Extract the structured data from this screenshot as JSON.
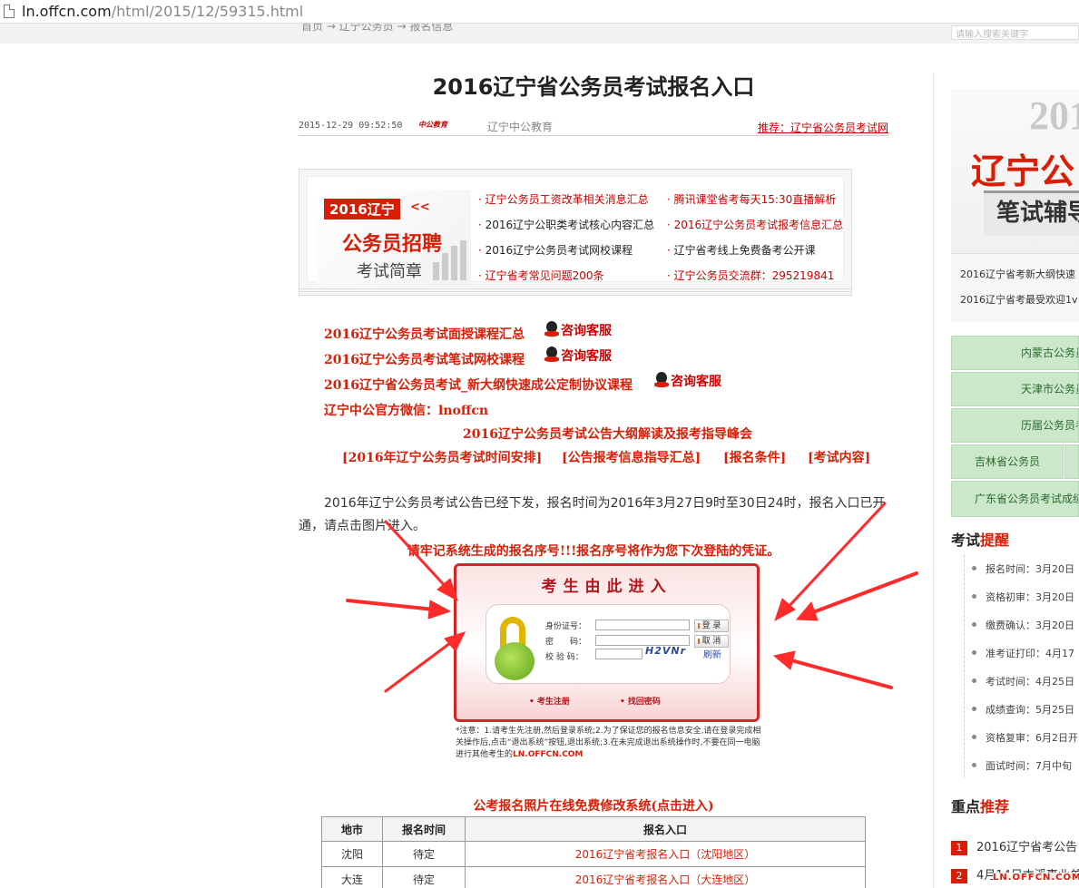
{
  "browser": {
    "url_host": "ln.offcn.com",
    "url_path": "/html/2015/12/59315.html"
  },
  "nav": {
    "crumbs": "首页 → 辽宁公务员 → 报名信息",
    "search_placeholder": "请输入搜索关键字"
  },
  "article": {
    "title": "2016辽宁省公务员考试报名入口",
    "date": "2015-12-29 09:52:50",
    "logo_text": "中公教育",
    "source": "辽宁中公教育",
    "recommend": "推荐：辽宁省公务员考试网"
  },
  "banner": {
    "tag": "2016辽宁",
    "arrows": "<<",
    "title": "公务员招聘",
    "subtitle": "考试简章",
    "links": [
      "辽宁公务员工资改革相关消息汇总",
      "腾讯课堂省考每天15:30直播解析",
      "2016辽宁公职类考试核心内容汇总",
      "2016辽宁公务员考试报考信息汇总",
      "2016辽宁公务员考试网校课程",
      "辽宁省考线上免费备考公开课",
      "辽宁省考常见问题200条",
      "辽宁公务员交流群：295219841"
    ]
  },
  "promo": {
    "l1": "2016辽宁公务员考试面授课程汇总",
    "l2": "2016辽宁公务员考试笔试网校课程",
    "l3": "2016辽宁省公务员考试_新大纲快速成公定制协议课程",
    "consult": "咨询客服",
    "wechat": "辽宁中公官方微信：lnoffcn",
    "center": "2016辽宁公务员考试公告大纲解读及报考指导峰会",
    "b1": "[2016年辽宁公务员考试时间安排]",
    "b2": "[公告报考信息指导汇总]",
    "b3": "[报名条件]",
    "b4": "[考试内容]"
  },
  "body": {
    "paragraph": "2016年辽宁公务员考试公告已经下发，报名时间为2016年3月27日9时至30日24时，报名入口已开通，请点击图片进入。",
    "warning": "请牢记系统生成的报名序号!!!报名序号将作为您下次登陆的凭证。"
  },
  "login": {
    "header": "考生由此进入",
    "id_label": "身份证号：",
    "pwd_label": "密　　码：",
    "code_label": "校 验 码：",
    "captcha": "H2VNr",
    "refresh": "刷新",
    "login_btn": "登 录",
    "cancel_btn": "取 消",
    "register": "• 考生注册",
    "forgot": "• 找回密码"
  },
  "note": {
    "text": "*注意：1.请考生先注册,然后登录系统;2.为了保证您的报名信息安全,请在登录完成相关操作后,点击“退出系统”按钮,退出系统;3.在未完成退出系统操作时,不要在同一电脑进行其他考生的",
    "watermark": "LN.OFFCN.COM"
  },
  "photo_system": "公考报名照片在线免费修改系统(点击进入)",
  "table": {
    "headers": [
      "地市",
      "报名时间",
      "报名入口"
    ],
    "rows": [
      [
        "沈阳",
        "待定",
        "2016辽宁省考报名入口（沈阳地区）"
      ],
      [
        "大连",
        "待定",
        "2016辽宁省考报名入口（大连地区）"
      ]
    ]
  },
  "sidebar": {
    "ad_year": "201",
    "ad_province": "辽宁公",
    "ad_sub": "笔试辅导",
    "ad_line1": "2016辽宁省考新大纲快速",
    "ad_line2": "2016辽宁省考最受欢迎1v",
    "green": [
      "内蒙古公务员",
      "天津市公务员",
      "历届公务员考",
      "吉林省公务员",
      "广东省公务员考试成绩"
    ],
    "reminder_title_a": "考试",
    "reminder_title_b": "提醒",
    "timeline": [
      "报名时间：3月20日",
      "资格初审：3月20日",
      "缴费确认：3月20日",
      "准考证打印：4月17",
      "考试时间：4月25日",
      "成绩查询：5月25日",
      "资格复审：6月2日开",
      "面试时间：7月中旬"
    ],
    "recommend_title_a": "重点",
    "recommend_title_b": "推荐",
    "recommend": [
      {
        "num": "1",
        "text": "2016辽宁省考公告"
      },
      {
        "num": "2",
        "text": "4月14日本溪事业单"
      }
    ],
    "watermark": "LN.OFFCN.COM"
  },
  "colors": {
    "accent_red": "#d81e06",
    "green_btn": "#cbe8cb"
  }
}
